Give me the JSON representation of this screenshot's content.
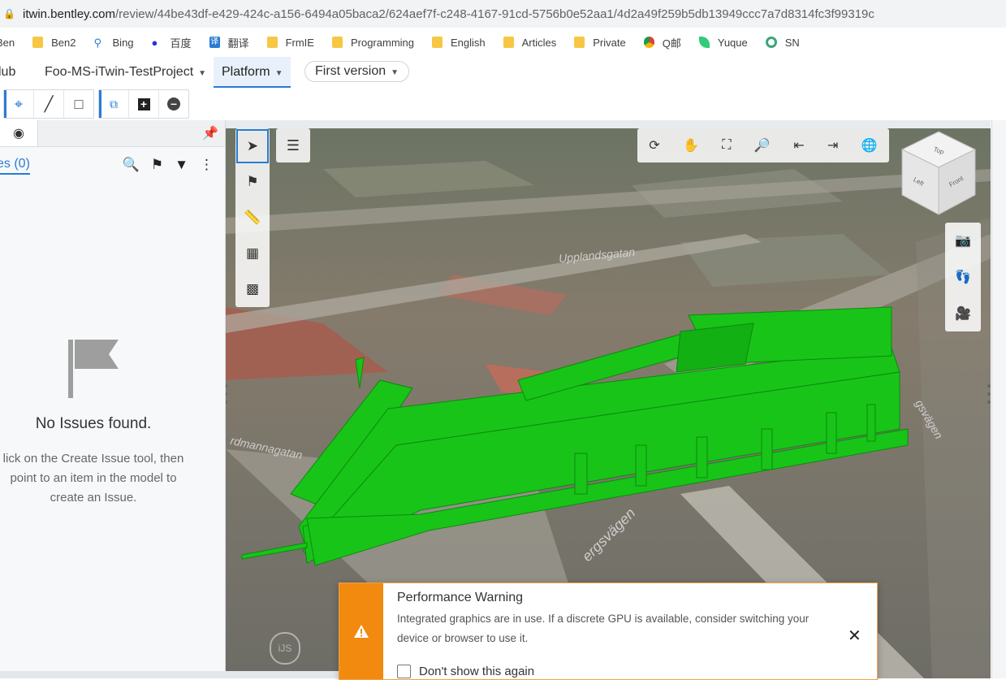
{
  "browser": {
    "url_host": "itwin.bentley.com",
    "url_path": "/review/44be43df-e429-424c-a156-6494a05baca2/624aef7f-c248-4167-91cd-5756b0e52aa1/4d2a49f259b5db13949ccc7a7d8314fc3f99319c"
  },
  "bookmarks": [
    {
      "label": "Ben",
      "icon": "folder-icon"
    },
    {
      "label": "Ben2",
      "icon": "folder-icon"
    },
    {
      "label": "Bing",
      "icon": "search-icon"
    },
    {
      "label": "百度",
      "icon": "paw-icon"
    },
    {
      "label": "翻译",
      "icon": "translate-icon"
    },
    {
      "label": "FrmIE",
      "icon": "folder-icon"
    },
    {
      "label": "Programming",
      "icon": "folder-icon"
    },
    {
      "label": "English",
      "icon": "folder-icon"
    },
    {
      "label": "Articles",
      "icon": "folder-icon"
    },
    {
      "label": "Private",
      "icon": "folder-icon"
    },
    {
      "label": "Q邮",
      "icon": "chrome-icon"
    },
    {
      "label": "Yuque",
      "icon": "leaf-icon"
    },
    {
      "label": "SN",
      "icon": "ring-icon"
    }
  ],
  "header": {
    "hub": "lub",
    "project": "Foo-MS-iTwin-TestProject",
    "platform": "Platform",
    "version": "First version"
  },
  "issues_panel": {
    "tab_label": "es (0)",
    "empty_title": "No Issues found.",
    "empty_desc": "lick on the Create Issue tool, then point to an item in the model to create an Issue."
  },
  "viewport": {
    "streets": [
      "Upplandsgatan",
      "rdmannagatan",
      "ergsvägen",
      "gsvägen"
    ],
    "cube_faces": [
      "Top",
      "Left",
      "Front"
    ],
    "model_color": "#18c418"
  },
  "toast": {
    "title": "Performance Warning",
    "message": "Integrated graphics are in use. If a discrete GPU is available, consider switching your device or browser to use it.",
    "checkbox_label": "Don't show this again",
    "accent": "#f18a0e"
  }
}
